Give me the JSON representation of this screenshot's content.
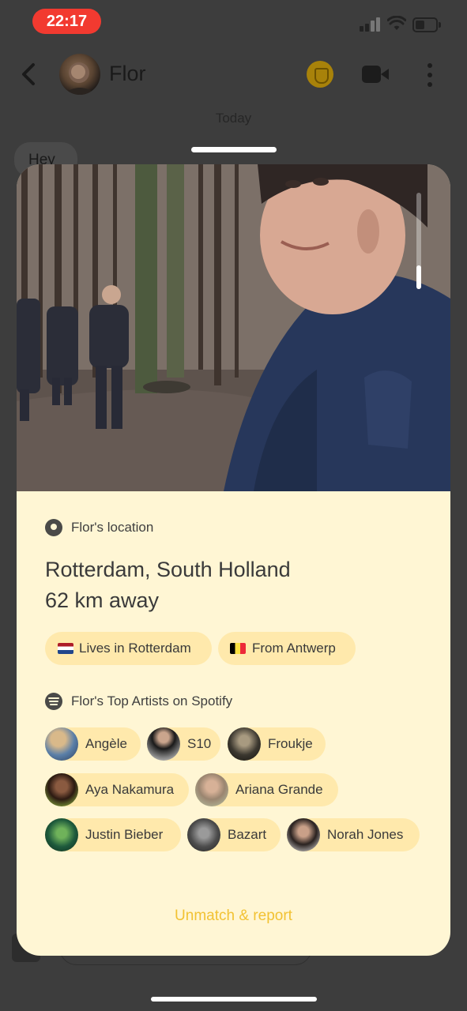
{
  "status_bar": {
    "time": "22:17",
    "icons": [
      "signal-icon",
      "wifi-icon",
      "battery-icon"
    ]
  },
  "chat": {
    "name": "Flor",
    "date_separator": "Today",
    "first_message_preview": "Hey"
  },
  "profile_sheet": {
    "location_heading": "Flor's location",
    "city": "Rotterdam, South Holland",
    "distance": "62 km away",
    "chips": [
      {
        "flag": "nl",
        "label": "Lives in Rotterdam"
      },
      {
        "flag": "be",
        "label": "From Antwerp"
      }
    ],
    "spotify_heading": "Flor's Top Artists on Spotify",
    "artists": [
      "Angèle",
      "S10",
      "Froukje",
      "Aya Nakamura",
      "Ariana Grande",
      "Justin Bieber",
      "Bazart",
      "Norah Jones"
    ],
    "unmatch_label": "Unmatch & report"
  },
  "colors": {
    "sheet_background": "#fff6d4",
    "chip_background": "#ffe9ac",
    "unmatch_text": "#f2c233",
    "time_pill": "#f23a30",
    "overlay": "#3d3d3d"
  }
}
